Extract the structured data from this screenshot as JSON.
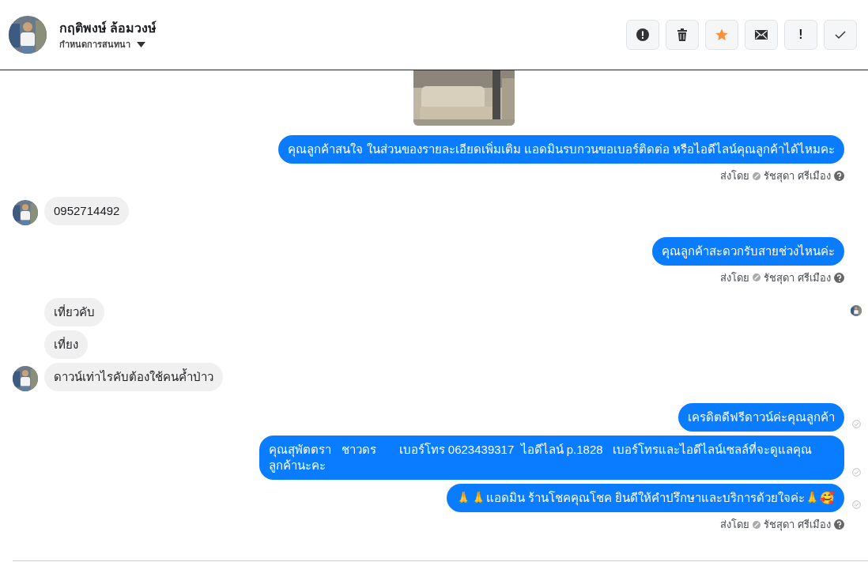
{
  "header": {
    "name": "กฤติพงษ์ ล้อมวงษ์",
    "subtitle": "กำหนดการสนทนา"
  },
  "toolbar": [
    {
      "kind": "alert"
    },
    {
      "kind": "trash"
    },
    {
      "kind": "star"
    },
    {
      "kind": "mail"
    },
    {
      "kind": "exclaim",
      "label": "!"
    },
    {
      "kind": "check"
    }
  ],
  "messages": [
    {
      "kind": "picture"
    },
    {
      "kind": "outgoing",
      "text": "คุณลูกค้าสนใจ ในส่วนของรายละเอียดเพิ่มเติม แอดมินรบกวนขอเบอร์ติดต่อ หรือไอดีไลน์คุณลูกค้าได้ไหมคะ",
      "delivered": false
    },
    {
      "kind": "sender",
      "label": "ส่งโดย",
      "name": "รัชสุดา ศรีเมือง"
    },
    {
      "kind": "incoming",
      "text": "0952714492",
      "avatar": true,
      "read_receipt": false
    },
    {
      "kind": "outgoing",
      "text": "คุณลูกค้าสะดวกรับสายช่วงไหนค่ะ",
      "delivered": false
    },
    {
      "kind": "sender",
      "label": "ส่งโดย",
      "name": "รัชสุดา ศรีเมือง"
    },
    {
      "kind": "incoming",
      "text": "เที่ยวคับ",
      "avatar": false,
      "read_receipt": true
    },
    {
      "kind": "incoming",
      "text": "เที่ยง",
      "avatar": false,
      "read_receipt": false
    },
    {
      "kind": "incoming",
      "text": "ดาวน์เท่าไรคับต้องใช้คนค้ำป่าว",
      "avatar": true,
      "read_receipt": false
    },
    {
      "kind": "outgoing",
      "text": "เครดิตดีฟรีดาวน์ค่ะคุณลูกค้า",
      "delivered": true
    },
    {
      "kind": "outgoing",
      "text": "คุณสุพัตตรา   ชาวดร       เบอร์โทร 0623439317  ไอดีไลน์ p.1828   เบอร์โทรและไอดีไลน์เซลล์ที่จะดูแลคุณลูกค้านะคะ",
      "delivered": true
    },
    {
      "kind": "outgoing",
      "text": "🙏🙏แอดมิน ร้านโชคคุณโชค ยินดีให้คำปรึกษาและบริการด้วยใจค่ะ🙏🥰",
      "delivered": true
    },
    {
      "kind": "sender",
      "label": "ส่งโดย",
      "name": "รัชสุดา ศรีเมือง"
    }
  ]
}
